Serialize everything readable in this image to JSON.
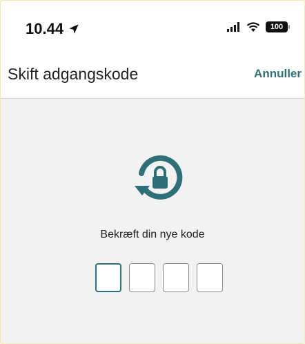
{
  "status_bar": {
    "time": "10.44",
    "battery": "100",
    "icons": [
      "location-arrow-icon",
      "signal-icon",
      "wifi-icon",
      "battery-icon"
    ]
  },
  "nav": {
    "title": "Skift adgangskode",
    "cancel_label": "Annuller"
  },
  "main": {
    "icon": "lock-reset-icon",
    "prompt": "Bekræft din nye kode",
    "code_length": 4,
    "active_index": 0
  },
  "colors": {
    "accent": "#2f6f78",
    "background": "#f2f2f2"
  }
}
